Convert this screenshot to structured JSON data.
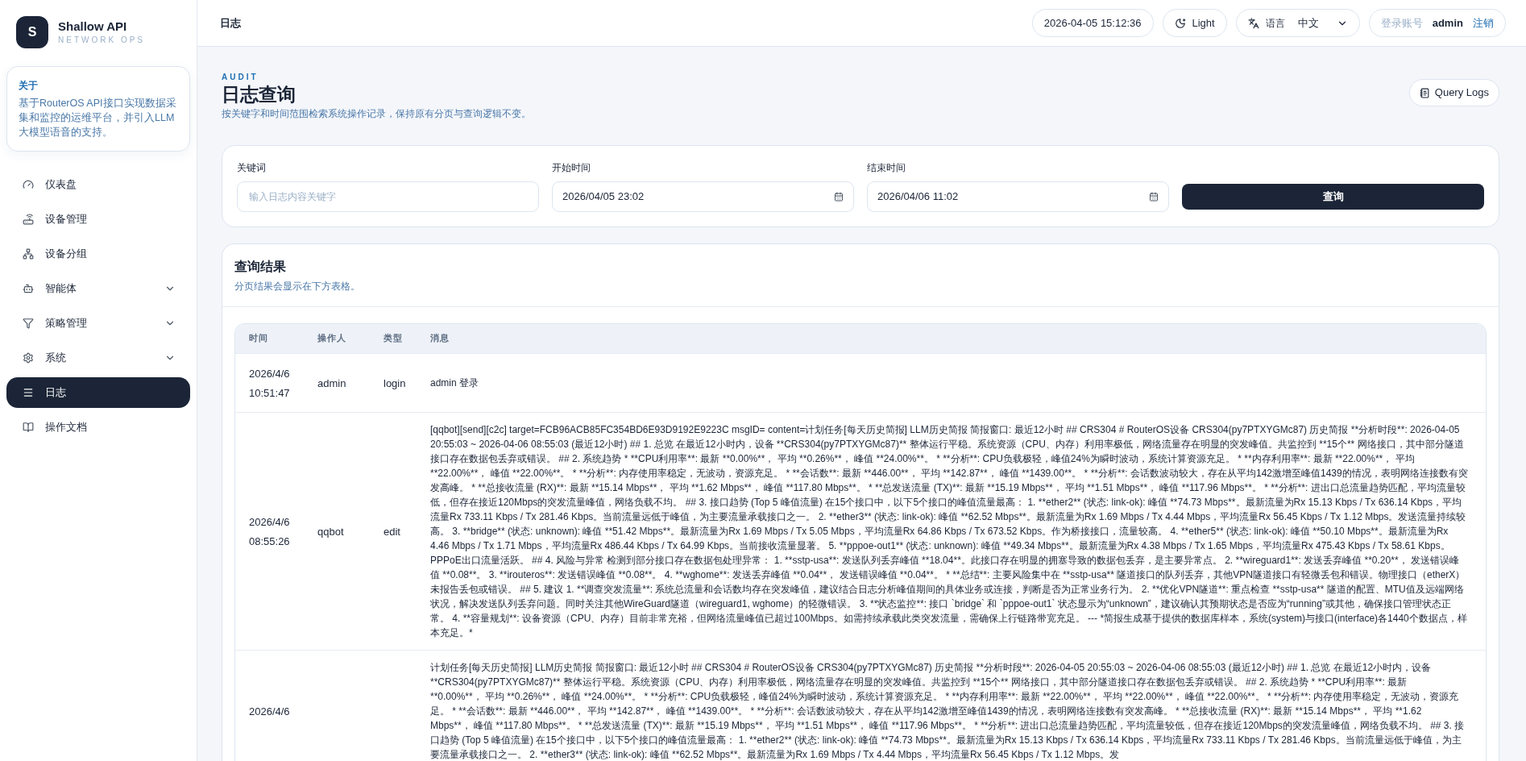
{
  "brand": {
    "logo_letter": "S",
    "name": "Shallow API",
    "tagline": "NETWORK OPS"
  },
  "about": {
    "title": "关于",
    "text": "基于RouterOS API接口实现数据采集和监控的运维平台，并引入LLM大模型语音的支持。"
  },
  "nav": [
    {
      "label": "仪表盘",
      "selected": false,
      "has_submenu": false
    },
    {
      "label": "设备管理",
      "selected": false,
      "has_submenu": false
    },
    {
      "label": "设备分组",
      "selected": false,
      "has_submenu": false
    },
    {
      "label": "智能体",
      "selected": false,
      "has_submenu": true
    },
    {
      "label": "策略管理",
      "selected": false,
      "has_submenu": true
    },
    {
      "label": "系统",
      "selected": false,
      "has_submenu": true
    },
    {
      "label": "日志",
      "selected": true,
      "has_submenu": false
    },
    {
      "label": "操作文档",
      "selected": false,
      "has_submenu": false
    }
  ],
  "header": {
    "title": "日志",
    "datetime": "2026-04-05 15:12:36",
    "theme": "Light",
    "language_label": "语言",
    "language": "中文",
    "account_label": "登录账号",
    "account": "admin",
    "logout": "注销"
  },
  "page": {
    "eyebrow": "AUDIT",
    "title": "日志查询",
    "subtitle": "按关键字和时间范围检索系统操作记录，保持原有分页与查询逻辑不变。",
    "action": "Query Logs"
  },
  "filters": {
    "fields": [
      {
        "kind": "text",
        "label": "关键词",
        "placeholder": "输入日志内容关键字"
      },
      {
        "kind": "date",
        "label": "开始时间",
        "value": "2026/04/05 23:02"
      },
      {
        "kind": "date",
        "label": "结束时间",
        "value": "2026/04/06 11:02"
      }
    ],
    "submit": "查询"
  },
  "results": {
    "title": "查询结果",
    "subtitle": "分页结果会显示在下方表格。",
    "columns": [
      "时间",
      "操作人",
      "类型",
      "消息"
    ],
    "rows": [
      {
        "time": "2026/4/6 10:51:47",
        "operator": "admin",
        "type": "login",
        "message": "admin 登录"
      },
      {
        "time": "2026/4/6 08:55:26",
        "operator": "qqbot",
        "type": "edit",
        "message": "[qqbot][send][c2c] target=FCB96ACB85FC354BD6E93D9192E9223C msgID= content=计划任务[每天历史简报] LLM历史简报 简报窗口: 最近12小时 ## CRS304 # RouterOS设备 CRS304(py7PTXYGMc87) 历史简报 **分析时段**: 2026-04-05 20:55:03 ~ 2026-04-06 08:55:03 (最近12小时) ## 1. 总览 在最近12小时内，设备 **CRS304(py7PTXYGMc87)** 整体运行平稳。系统资源（CPU、内存）利用率极低，网络流量存在明显的突发峰值。共监控到 **15个** 网络接口，其中部分隧道接口存在数据包丢弃或错误。 ## 2. 系统趋势 * **CPU利用率**: 最新 **0.00%**， 平均 **0.26%**， 峰值 **24.00%**。 * **分析**: CPU负载极轻，峰值24%为瞬时波动，系统计算资源充足。 * **内存利用率**: 最新 **22.00%**， 平均 **22.00%**， 峰值 **22.00%**。 * **分析**: 内存使用率稳定，无波动，资源充足。 * **会话数**: 最新 **446.00**， 平均 **142.87**， 峰值 **1439.00**。 * **分析**: 会话数波动较大，存在从平均142激增至峰值1439的情况，表明网络连接数有突发高峰。 * **总接收流量 (RX)**: 最新 **15.14 Mbps**， 平均 **1.62 Mbps**， 峰值 **117.80 Mbps**。 * **总发送流量 (TX)**: 最新 **15.19 Mbps**， 平均 **1.51 Mbps**， 峰值 **117.96 Mbps**。 * **分析**: 进出口总流量趋势匹配，平均流量较低，但存在接近120Mbps的突发流量峰值，网络负载不均。 ## 3. 接口趋势 (Top 5 峰值流量) 在15个接口中，以下5个接口的峰值流量最高： 1. **ether2** (状态: link-ok): 峰值 **74.73 Mbps**。最新流量为Rx 15.13 Kbps / Tx 636.14 Kbps，平均流量Rx 733.11 Kbps / Tx 281.46 Kbps。当前流量远低于峰值，为主要流量承载接口之一。 2. **ether3** (状态: link-ok): 峰值 **62.52 Mbps**。最新流量为Rx 1.69 Mbps / Tx 4.44 Mbps，平均流量Rx 56.45 Kbps / Tx 1.12 Mbps。发送流量持续较高。 3. **bridge** (状态: unknown): 峰值 **51.42 Mbps**。最新流量为Rx 1.69 Mbps / Tx 5.05 Mbps，平均流量Rx 64.86 Kbps / Tx 673.52 Kbps。作为桥接接口，流量较高。 4. **ether5** (状态: link-ok): 峰值 **50.10 Mbps**。最新流量为Rx 4.46 Mbps / Tx 1.71 Mbps，平均流量Rx 486.44 Kbps / Tx 64.99 Kbps。当前接收流量显著。 5. **pppoe-out1** (状态: unknown): 峰值 **49.34 Mbps**。最新流量为Rx 4.38 Mbps / Tx 1.65 Mbps，平均流量Rx 475.43 Kbps / Tx 58.61 Kbps。PPPoE出口流量活跃。 ## 4. 风险与异常 检测到部分接口存在数据包处理异常： 1. **sstp-usa**: 发送队列丢弃峰值 **18.04**。此接口存在明显的拥塞导致的数据包丢弃，是主要异常点。 2. **wireguard1**: 发送丢弃峰值 **0.20**， 发送错误峰值 **0.08**。 3. **irouteros**: 发送错误峰值 **0.08**。 4. **wghome**: 发送丢弃峰值 **0.04**， 发送错误峰值 **0.04**。 * **总结**: 主要风险集中在 **sstp-usa** 隧道接口的队列丢弃，其他VPN隧道接口有轻微丢包和错误。物理接口（etherX）未报告丢包或错误。 ## 5. 建议 1. **调查突发流量**: 系统总流量和会话数均存在突发峰值，建议结合日志分析峰值期间的具体业务或连接，判断是否为正常业务行为。 2. **优化VPN隧道**: 重点检查 **sstp-usa** 隧道的配置、MTU值及远端网络状况，解决发送队列丢弃问题。同时关注其他WireGuard隧道（wireguard1, wghome）的轻微错误。 3. **状态监控**: 接口 `bridge` 和 `pppoe-out1` 状态显示为“unknown”，建议确认其预期状态是否应为“running”或其他，确保接口管理状态正常。 4. **容量规划**: 设备资源（CPU、内存）目前非常充裕，但网络流量峰值已超过100Mbps。如需持续承载此类突发流量，需确保上行链路带宽充足。 --- *简报生成基于提供的数据库样本，系统(system)与接口(interface)各1440个数据点，样本充足。*"
      },
      {
        "time": "2026/4/6",
        "message": "计划任务[每天历史简报] LLM历史简报 简报窗口: 最近12小时 ## CRS304 # RouterOS设备 CRS304(py7PTXYGMc87) 历史简报 **分析时段**: 2026-04-05 20:55:03 ~ 2026-04-06 08:55:03 (最近12小时) ## 1. 总览 在最近12小时内，设备 **CRS304(py7PTXYGMc87)** 整体运行平稳。系统资源（CPU、内存）利用率极低，网络流量存在明显的突发峰值。共监控到 **15个** 网络接口，其中部分隧道接口存在数据包丢弃或错误。 ## 2. 系统趋势 * **CPU利用率**: 最新 **0.00%**， 平均 **0.26%**， 峰值 **24.00%**。 * **分析**: CPU负载极轻，峰值24%为瞬时波动，系统计算资源充足。 * **内存利用率**: 最新 **22.00%**， 平均 **22.00%**， 峰值 **22.00%**。 * **分析**: 内存使用率稳定，无波动，资源充足。 * **会话数**: 最新 **446.00**， 平均 **142.87**， 峰值 **1439.00**。 * **分析**: 会话数波动较大，存在从平均142激增至峰值1439的情况，表明网络连接数有突发高峰。 * **总接收流量 (RX)**: 最新 **15.14 Mbps**， 平均 **1.62 Mbps**， 峰值 **117.80 Mbps**。 * **总发送流量 (TX)**: 最新 **15.19 Mbps**， 平均 **1.51 Mbps**， 峰值 **117.96 Mbps**。 * **分析**: 进出口总流量趋势匹配，平均流量较低，但存在接近120Mbps的突发流量峰值，网络负载不均。 ## 3. 接口趋势 (Top 5 峰值流量) 在15个接口中，以下5个接口的峰值流量最高： 1. **ether2** (状态: link-ok): 峰值 **74.73 Mbps**。最新流量为Rx 15.13 Kbps / Tx 636.14 Kbps，平均流量Rx 733.11 Kbps / Tx 281.46 Kbps。当前流量远低于峰值，为主要流量承载接口之一。 2. **ether3** (状态: link-ok): 峰值 **62.52 Mbps**。最新流量为Rx 1.69 Mbps / Tx 4.44 Mbps，平均流量Rx 56.45 Kbps / Tx 1.12 Mbps。发"
      }
    ]
  }
}
